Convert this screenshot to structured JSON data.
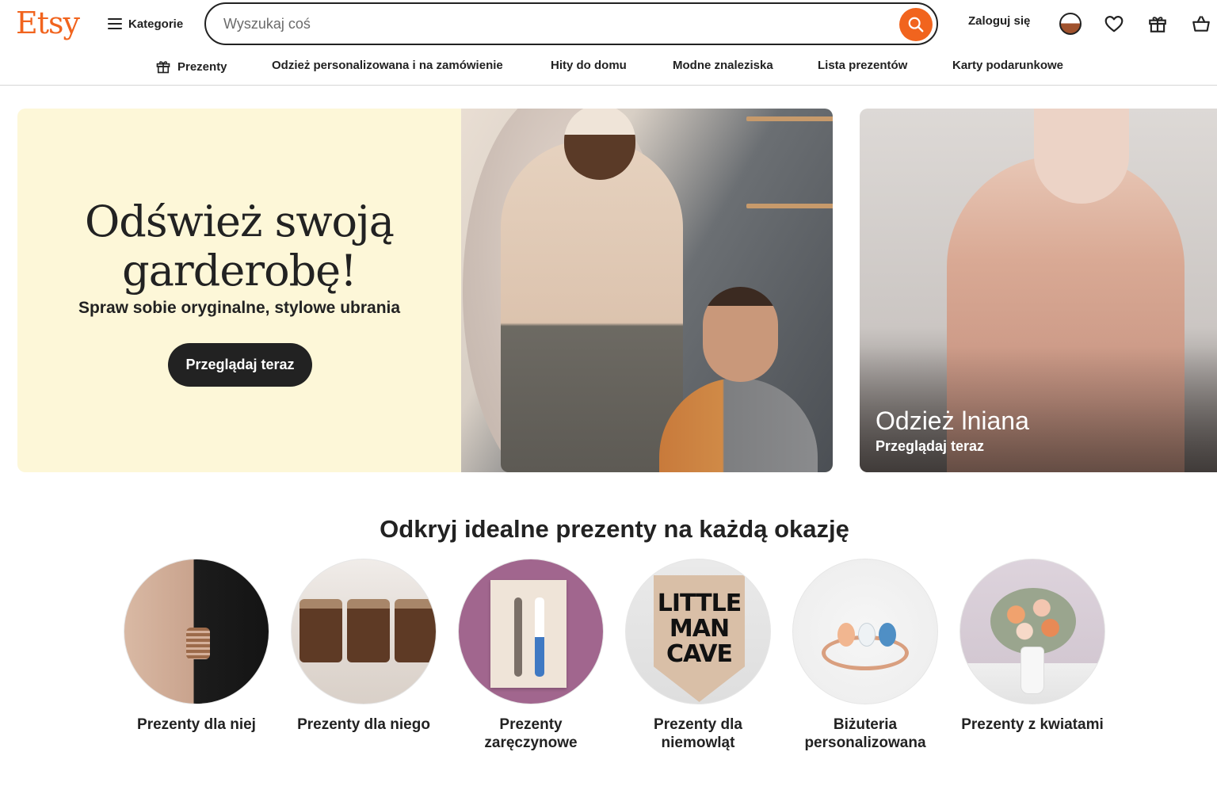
{
  "header": {
    "logo": "Etsy",
    "categories_label": "Kategorie",
    "search": {
      "placeholder": "Wyszukaj coś",
      "value": ""
    },
    "signin_label": "Zaloguj się",
    "icons": [
      "locale-icon",
      "heart-icon",
      "gift-icon",
      "basket-icon"
    ]
  },
  "nav": {
    "items": [
      {
        "label": "Prezenty",
        "icon": "gift-icon"
      },
      {
        "label": "Odzież personalizowana i na zamówienie"
      },
      {
        "label": "Hity do domu"
      },
      {
        "label": "Modne znaleziska"
      },
      {
        "label": "Lista prezentów"
      },
      {
        "label": "Karty podarunkowe"
      }
    ]
  },
  "hero": {
    "title_line1": "Odśwież swoją",
    "title_line2": "garderobę!",
    "subtitle": "Spraw sobie oryginalne, stylowe ubrania",
    "button": "Przeglądaj teraz"
  },
  "side_card": {
    "title": "Odzież lniana",
    "subtitle": "Przeglądaj teraz"
  },
  "gifts": {
    "title": "Odkryj idealne prezenty na każdą okazję",
    "items": [
      {
        "label_line1": "Prezenty dla niej",
        "label_line2": ""
      },
      {
        "label_line1": "Prezenty dla niego",
        "label_line2": ""
      },
      {
        "label_line1": "Prezenty",
        "label_line2": "zaręczynowe"
      },
      {
        "label_line1": "Prezenty dla",
        "label_line2": "niemowląt",
        "sign_text": "LITTLE MAN CAVE"
      },
      {
        "label_line1": "Biżuteria",
        "label_line2": "personalizowana"
      },
      {
        "label_line1": "Prezenty z kwiatami",
        "label_line2": ""
      }
    ]
  },
  "colors": {
    "brand": "#f1641e",
    "text": "#222222",
    "hero_bg": "#fdf7d8"
  }
}
